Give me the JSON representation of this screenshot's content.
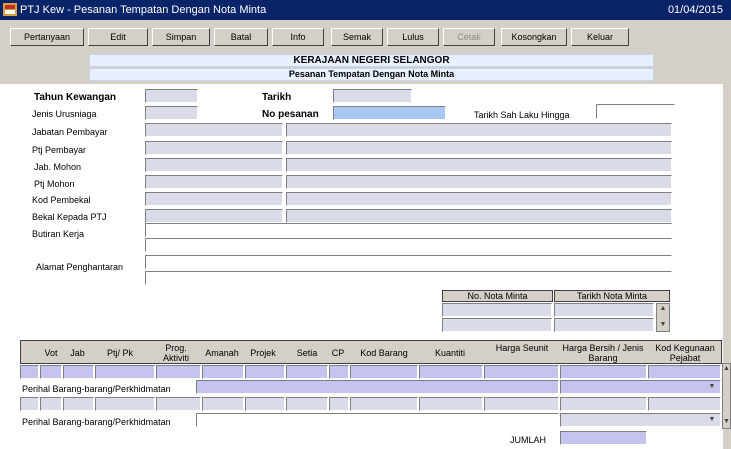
{
  "window": {
    "title": "PTJ Kew - Pesanan Tempatan Dengan Nota Minta",
    "date": "01/04/2015"
  },
  "toolbar": [
    "Pertanyaan",
    "Edit",
    "Simpan",
    "Batal",
    "Info",
    "Semak",
    "Lulus",
    "Cetak",
    "Kosongkan",
    "Keluar"
  ],
  "header": {
    "state": "KERAJAAN NEGERI SELANGOR",
    "form_title": "Pesanan Tempatan Dengan Nota Minta"
  },
  "form": {
    "tahun_kewangan": "Tahun Kewangan",
    "tarikh": "Tarikh",
    "jenis_urusniaga": "Jenis Urusniaga",
    "no_pesanan": "No pesanan",
    "tarikh_sah": "Tarikh Sah Laku Hingga",
    "jabatan_pembayar": "Jabatan Pembayar",
    "ptj_pembayar": "Ptj Pembayar",
    "jab_mohon": "Jab. Mohon",
    "ptj_mohon": "Ptj Mohon",
    "kod_pembekal": "Kod Pembekal",
    "bekal_kepada": "Bekal Kepada PTJ",
    "butiran_kerja": "Butiran Kerja",
    "alamat": "Alamat Penghantaran"
  },
  "nota": {
    "col1": "No. Nota Minta",
    "col2": "Tarikh Nota Minta"
  },
  "grid": {
    "columns": [
      "Vot",
      "Jab",
      "Ptj/ Pk",
      "Prog. Aktiviti",
      "Amanah",
      "Projek",
      "Setia",
      "CP",
      "Kod Barang",
      "Kuantiti",
      "Harga Seunit",
      "Harga Bersih / Jenis Barang",
      "Kod Kegunaan Pejabat"
    ],
    "perihal": "Perihal Barang-barang/Perkhidmatan",
    "jumlah": "JUMLAH"
  },
  "colors": {
    "titlebar": "#0a246a",
    "field": "#d9dbe8",
    "highlight": "#a8c8f4",
    "purple": "#c4c4ee"
  }
}
